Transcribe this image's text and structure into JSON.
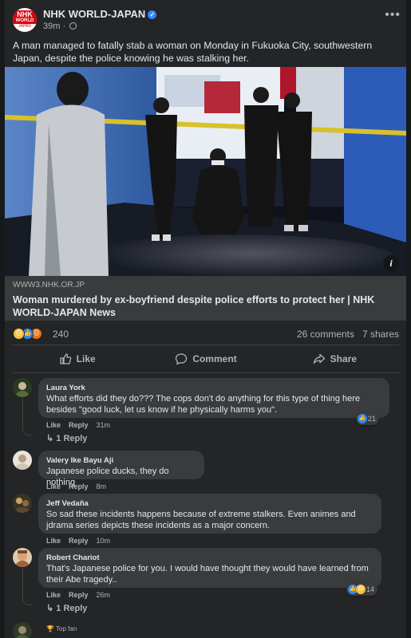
{
  "post": {
    "page_name": "NHK WORLD-JAPAN",
    "time": "39m",
    "avatar_line1": "NHK",
    "avatar_line2": "WORLD",
    "avatar_line3": "JAPAN",
    "text": "A man managed to fatally stab a woman on Monday in Fukuoka City, southwestern Japan, despite the police knowing he was stalking her.",
    "more_icon": "•••"
  },
  "link": {
    "domain": "WWW3.NHK.OR.JP",
    "title": "Woman murdered by ex-boyfriend despite police efforts to protect her | NHK WORLD-JAPAN News"
  },
  "reactions": {
    "count": "240",
    "comments": "26 comments",
    "shares": "7 shares"
  },
  "actions": {
    "like": "Like",
    "comment": "Comment",
    "share": "Share"
  },
  "comments": [
    {
      "author": "Laura York",
      "text": "What efforts did they do??? The cops don't do anything for this type of thing here besides \"good luck, let us know if he physically harms you\".",
      "like": "Like",
      "reply": "Reply",
      "time": "31m",
      "reaction_count": "21",
      "replies": "1 Reply"
    },
    {
      "author": "Valery Ike Bayu Aji",
      "text": "Japanese police ducks, they do nothing",
      "like": "Like",
      "reply": "Reply",
      "time": "8m"
    },
    {
      "author": "Jeff Vedaña",
      "text": "So sad these incidents happens because of extreme stalkers. Even animes and jdrama series depicts these incidents as a major concern.",
      "like": "Like",
      "reply": "Reply",
      "time": "10m"
    },
    {
      "author": "Robert Chariot",
      "text": "That's Japanese police for you. I would have thought they would have learned from their Abe tragedy..",
      "like": "Like",
      "reply": "Reply",
      "time": "26m",
      "reaction_count": "14",
      "replies": "1 Reply"
    },
    {
      "badge": "Top fan"
    }
  ],
  "colors": {
    "background": "#18191a",
    "card": "#242526",
    "bubble": "#3a3b3c",
    "text_primary": "#e4e6eb",
    "text_secondary": "#b0b3b8",
    "accent": "#2d88ff"
  }
}
